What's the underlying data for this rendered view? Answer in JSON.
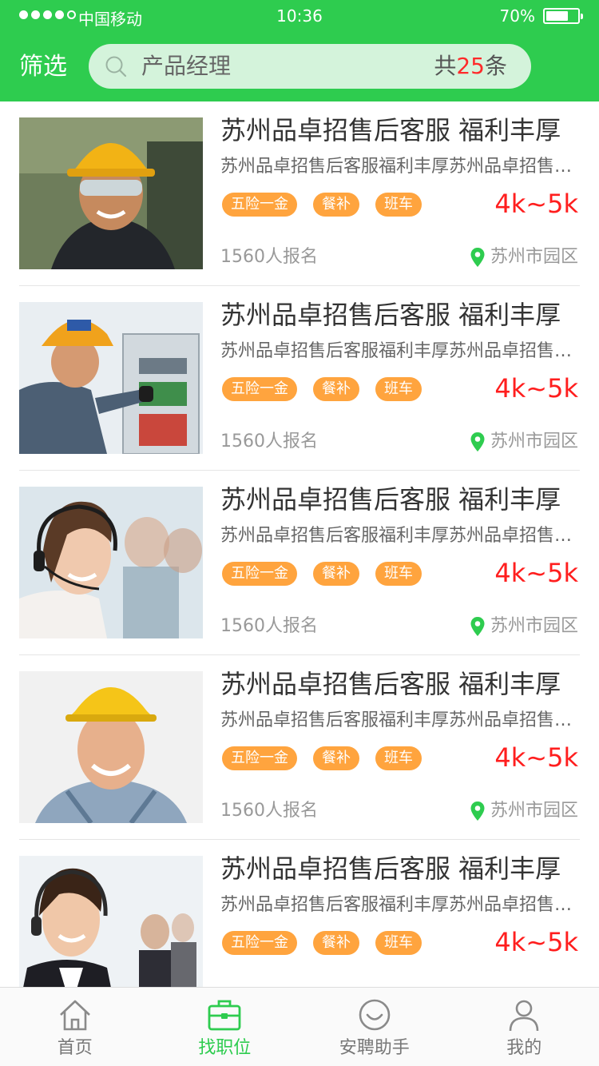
{
  "status_bar": {
    "carrier": "中国移动",
    "time": "10:36",
    "battery_text": "70%",
    "battery_level": 0.7,
    "signal_bars_filled": 4,
    "signal_bars_total": 5
  },
  "header": {
    "filter_label": "筛选",
    "search_value": "产品经理",
    "count_prefix": "共",
    "count_value": "25",
    "count_suffix": "条"
  },
  "colors": {
    "brand_green": "#2ECC4F",
    "search_bg": "#D4F3DB",
    "tag_orange": "#FFA43E",
    "salary_red": "#FF1E1E"
  },
  "jobs": [
    {
      "title": "苏州品卓招售后客服 福利丰厚",
      "desc": "苏州品卓招售后客服福利丰厚苏州品卓招售后客服",
      "tags": [
        "五险一金",
        "餐补",
        "班车"
      ],
      "salary": "4k~5k",
      "applicants": "1560人报名",
      "location": "苏州市园区",
      "image": "worker-hardhat-goggles"
    },
    {
      "title": "苏州品卓招售后客服 福利丰厚",
      "desc": "苏州品卓招售后客服福利丰厚苏州品卓招售后客服",
      "tags": [
        "五险一金",
        "餐补",
        "班车"
      ],
      "salary": "4k~5k",
      "applicants": "1560人报名",
      "location": "苏州市园区",
      "image": "electrician-panel"
    },
    {
      "title": "苏州品卓招售后客服 福利丰厚",
      "desc": "苏州品卓招售后客服福利丰厚苏州品卓招售后客服",
      "tags": [
        "五险一金",
        "餐补",
        "班车"
      ],
      "salary": "4k~5k",
      "applicants": "1560人报名",
      "location": "苏州市园区",
      "image": "headset-agent"
    },
    {
      "title": "苏州品卓招售后客服 福利丰厚",
      "desc": "苏州品卓招售后客服福利丰厚苏州品卓招售后客服",
      "tags": [
        "五险一金",
        "餐补",
        "班车"
      ],
      "salary": "4k~5k",
      "applicants": "1560人报名",
      "location": "苏州市园区",
      "image": "worker-hardhat-smile"
    },
    {
      "title": "苏州品卓招售后客服 福利丰厚",
      "desc": "苏州品卓招售后客服福利丰厚苏州品卓招售后客服",
      "tags": [
        "五险一金",
        "餐补",
        "班车"
      ],
      "salary": "4k~5k",
      "applicants": "",
      "location": "",
      "image": "callcenter-team"
    }
  ],
  "tabbar": {
    "items": [
      {
        "label": "首页",
        "icon": "home-icon",
        "active": false
      },
      {
        "label": "找职位",
        "icon": "briefcase-icon",
        "active": true
      },
      {
        "label": "安聘助手",
        "icon": "assistant-icon",
        "active": false
      },
      {
        "label": "我的",
        "icon": "profile-icon",
        "active": false
      }
    ]
  }
}
